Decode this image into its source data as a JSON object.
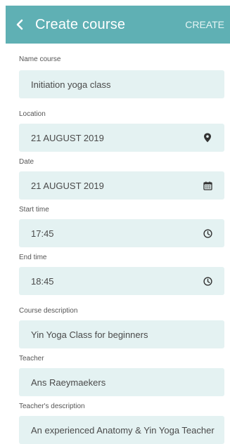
{
  "header": {
    "back_icon": "chevron-left-icon",
    "title": "Create course",
    "action_label": "CREATE",
    "background_color": "#5fb0b4"
  },
  "fields": [
    {
      "label": "Name course",
      "value": "Initiation yoga class",
      "icon": null
    },
    {
      "label": "Location",
      "value": "21 AUGUST 2019",
      "icon": "map-pin-icon"
    },
    {
      "label": "Date",
      "value": "21 AUGUST 2019",
      "icon": "calendar-icon"
    },
    {
      "label": "Start time",
      "value": "17:45",
      "icon": "clock-icon"
    },
    {
      "label": "End time",
      "value": "18:45",
      "icon": "clock-icon"
    },
    {
      "label": "Course description",
      "value": "Yin Yoga Class for beginners",
      "icon": null
    },
    {
      "label": "Teacher",
      "value": "Ans Raeymaekers",
      "icon": null
    },
    {
      "label": "Teacher's description",
      "value": "An experienced Anatomy & Yin Yoga Teacher",
      "icon": null
    }
  ],
  "field_background": "#e4f2f2"
}
